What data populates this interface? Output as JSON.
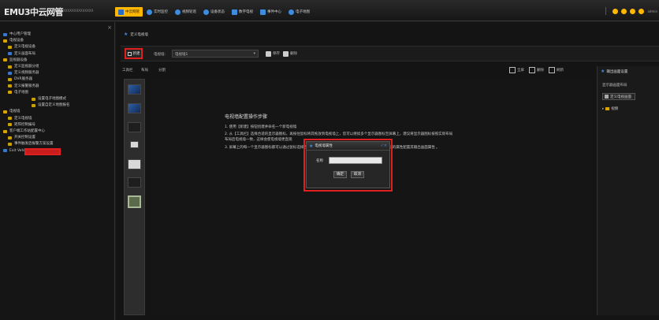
{
  "topbar": {
    "brand": "EMU3中云网管",
    "brand_sub": "XXXXXXXXXXXXXX",
    "tabs": [
      {
        "label": "中云网管",
        "icon": "home-icon",
        "color": "#2b6cc4",
        "active": true
      },
      {
        "label": "实时监控",
        "icon": "monitor-icon",
        "color": "#3d8ce0",
        "active": false
      },
      {
        "label": "视频轮巡",
        "icon": "video-icon",
        "color": "#3d8ce0",
        "active": false
      },
      {
        "label": "设备状态",
        "icon": "info-icon",
        "color": "#3d8ce0",
        "active": false
      },
      {
        "label": "数字电视",
        "icon": "tv-icon",
        "color": "#3d8ce0",
        "active": false
      },
      {
        "label": "事件中心",
        "icon": "event-icon",
        "color": "#3d8ce0",
        "active": false
      },
      {
        "label": "电子地图",
        "icon": "map-icon",
        "color": "#3d8ce0",
        "active": false
      }
    ],
    "user": "admin"
  },
  "sidebar": {
    "items": [
      {
        "label": "中心用户管理",
        "icon": "user-icon",
        "level": 0
      },
      {
        "label": "电视设备",
        "icon": "folder-icon",
        "level": 0
      },
      {
        "label": "定义电视设备",
        "icon": "device-icon",
        "level": 1
      },
      {
        "label": "定义画面布局",
        "icon": "layout-icon",
        "level": 1
      },
      {
        "label": "监视器设备",
        "icon": "folder-icon",
        "level": 0
      },
      {
        "label": "定义监视器分组",
        "icon": "group-icon",
        "level": 1
      },
      {
        "label": "定义视频服务器",
        "icon": "server-icon",
        "level": 1
      },
      {
        "label": "DVR服务器",
        "icon": "dvr-icon",
        "level": 1
      },
      {
        "label": "定义报警服务器",
        "icon": "alarm-icon",
        "level": 1
      },
      {
        "label": "电子地图",
        "icon": "folder-icon",
        "level": 1
      },
      {
        "label": "设置电子地图模式",
        "icon": "map-icon",
        "level": 2
      },
      {
        "label": "设置自定义地图报名",
        "icon": "map-icon",
        "level": 2
      },
      {
        "label": "电视墙",
        "icon": "folder-icon",
        "level": 0
      },
      {
        "label": "定义电视墙",
        "icon": "wall-icon",
        "level": 1
      },
      {
        "label": "矩阵控制编号",
        "icon": "matrix-icon",
        "level": 1
      },
      {
        "label": "客户端工作站配置中心",
        "icon": "folder-icon",
        "level": 0
      },
      {
        "label": "开关控制设置",
        "icon": "switch-icon",
        "level": 1
      },
      {
        "label": "事件触发后报警方案设置",
        "icon": "event-icon",
        "level": 1
      },
      {
        "label": "Exit Vehicle System",
        "icon": "exit-icon",
        "level": 0
      }
    ]
  },
  "main": {
    "breadcrumb": "定义电视墙",
    "toolbar": {
      "new_label": "新建",
      "wall_label": "电视墙:",
      "wall_value": "电视墙1",
      "save_label": "保存",
      "delete_label": "删除"
    },
    "subbar": {
      "tools_label": "工具栏",
      "layout_label": "布局",
      "divide_label": "分割",
      "right_btn_1": "全屏",
      "right_btn_2": "删除",
      "right_btn_3": "刷新"
    },
    "instructions": {
      "title": "电视墙配置操作步骤",
      "steps": [
        "1. 使用【新建】按钮创建并命名一个新电视墙",
        "2. 从【工具栏】选择合适的显示器图标，再按住鼠标将其拖放到电视墙上，您可以继续多个显示器图标至屏幕上，建议将显示器图标按照实际布局",
        "    布局后电视墙一致，这样会使电视墙更直观",
        "3. 屏幕上的每一个显示器图标都可以通过鼠标选择后拖放，再调整大小，也可以用鼠标右键每个显示器图标的属性配置其输出画面属性 。"
      ]
    },
    "dialog": {
      "title": "电视墙属性",
      "name_label": "名称",
      "name_value": "",
      "ok_label": "确定",
      "cancel_label": "取消"
    },
    "right_panel": {
      "title": "输出画面设置",
      "info": "显示器画面布局",
      "btn_label": "定义电视画面",
      "tree_item": "视频"
    }
  }
}
